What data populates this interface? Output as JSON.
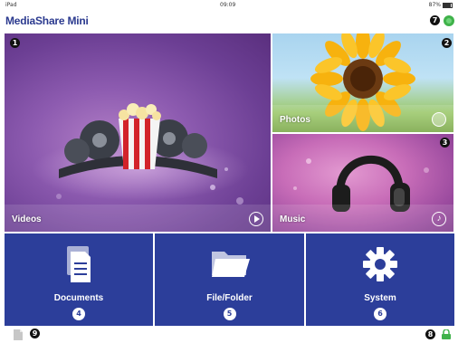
{
  "status": {
    "carrier": "iPad",
    "time": "09:09",
    "battery": "87%"
  },
  "app": {
    "title": "MediaShare Mini"
  },
  "badges": {
    "b1": "1",
    "b2": "2",
    "b3": "3",
    "b4": "4",
    "b5": "5",
    "b6": "6",
    "b7": "7",
    "b8": "8",
    "b9": "9"
  },
  "tiles": {
    "videos": {
      "label": "Videos"
    },
    "photos": {
      "label": "Photos"
    },
    "music": {
      "label": "Music"
    },
    "documents": {
      "label": "Documents"
    },
    "filefolder": {
      "label": "File/Folder"
    },
    "system": {
      "label": "System"
    }
  },
  "icons": {
    "videos": "play-circle-icon",
    "photos": "photo-circle-icon",
    "music": "music-note-icon",
    "documents": "documents-icon",
    "filefolder": "folder-icon",
    "system": "gear-icon"
  },
  "colors": {
    "title": "#2b3a8f",
    "tile_blue": "#2c3e9a",
    "status_green": "#3fb24a"
  }
}
